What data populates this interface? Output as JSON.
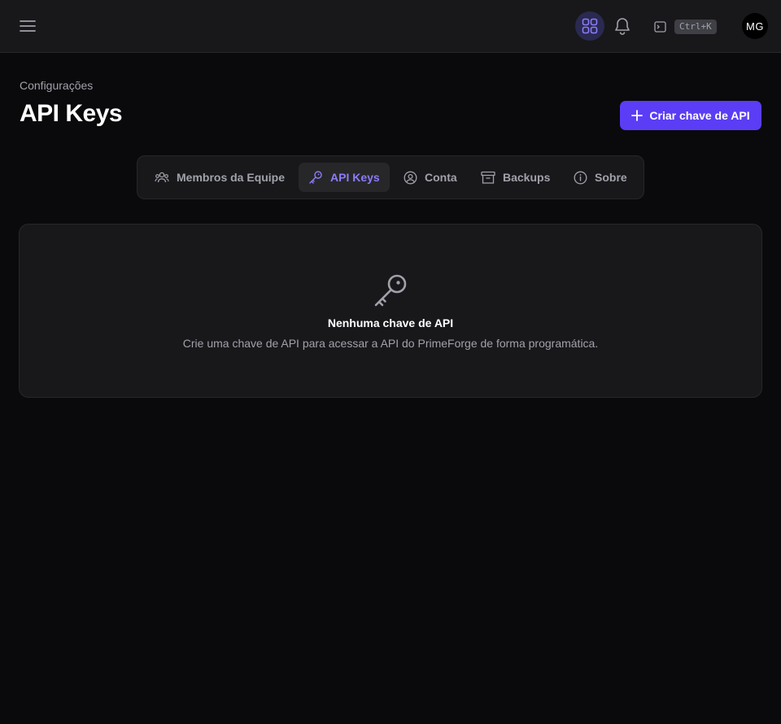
{
  "header": {
    "shortcut_key": "Ctrl+K",
    "avatar_initials": "MG",
    "icons": [
      "menu-icon",
      "apps-grid-icon",
      "bell-icon",
      "terminal-icon"
    ]
  },
  "page": {
    "breadcrumb": "Configurações",
    "title": "API Keys",
    "create_button_label": "Criar chave de API"
  },
  "tabs": [
    {
      "label": "Membros da Equipe",
      "icon": "users-icon",
      "active": false
    },
    {
      "label": "API Keys",
      "icon": "key-icon",
      "active": true
    },
    {
      "label": "Conta",
      "icon": "user-circle-icon",
      "active": false
    },
    {
      "label": "Backups",
      "icon": "archive-icon",
      "active": false
    },
    {
      "label": "Sobre",
      "icon": "info-icon",
      "active": false
    }
  ],
  "empty_state": {
    "icon": "key-icon",
    "title": "Nenhuma chave de API",
    "description": "Crie uma chave de API para acessar a API do PrimeForge de forma programática."
  },
  "colors": {
    "background": "#0a0a0c",
    "surface": "#18181b",
    "accent": "#5b3df5",
    "accent_text": "#8b7cf8"
  }
}
